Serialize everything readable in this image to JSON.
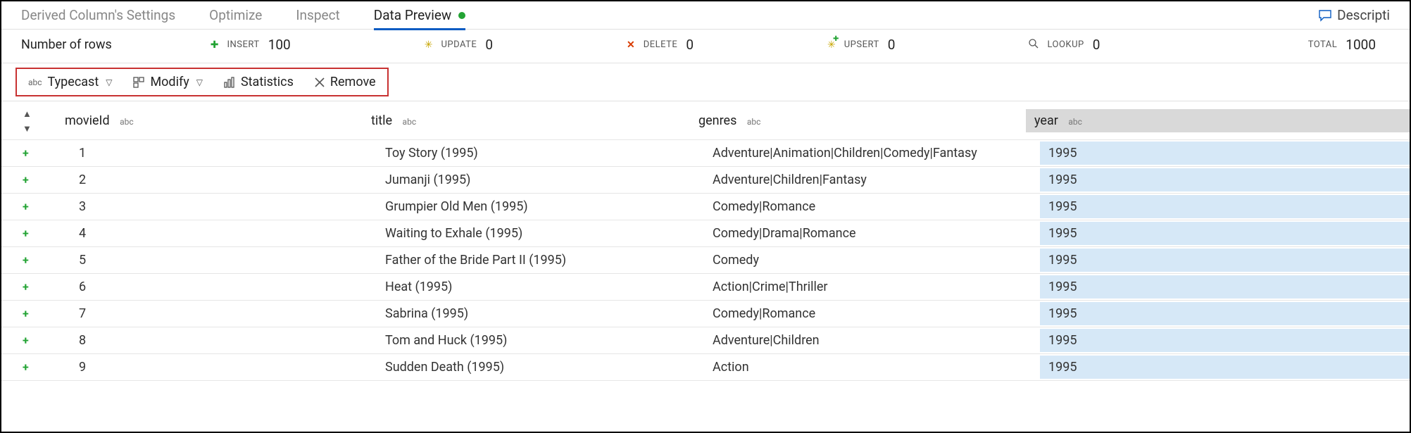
{
  "tabs": [
    {
      "label": "Derived Column's Settings",
      "active": false
    },
    {
      "label": "Optimize",
      "active": false
    },
    {
      "label": "Inspect",
      "active": false
    },
    {
      "label": "Data Preview",
      "active": true
    }
  ],
  "description_label": "Descripti",
  "counts": {
    "row_label": "Number of rows",
    "insert": {
      "label": "INSERT",
      "value": 100
    },
    "update": {
      "label": "UPDATE",
      "value": 0
    },
    "delete": {
      "label": "DELETE",
      "value": 0
    },
    "upsert": {
      "label": "UPSERT",
      "value": 0
    },
    "lookup": {
      "label": "LOOKUP",
      "value": 0
    },
    "total": {
      "label": "TOTAL",
      "value": 1000
    }
  },
  "actions": {
    "typecast": "Typecast",
    "modify": "Modify",
    "statistics": "Statistics",
    "remove": "Remove"
  },
  "table": {
    "columns": {
      "movieId": {
        "header": "movieId",
        "type": "abc"
      },
      "title": {
        "header": "title",
        "type": "abc"
      },
      "genres": {
        "header": "genres",
        "type": "abc"
      },
      "year": {
        "header": "year",
        "type": "abc"
      }
    },
    "rows": [
      {
        "id": "1",
        "title": "Toy Story (1995)",
        "genres": "Adventure|Animation|Children|Comedy|Fantasy",
        "year": "1995"
      },
      {
        "id": "2",
        "title": "Jumanji (1995)",
        "genres": "Adventure|Children|Fantasy",
        "year": "1995"
      },
      {
        "id": "3",
        "title": "Grumpier Old Men (1995)",
        "genres": "Comedy|Romance",
        "year": "1995"
      },
      {
        "id": "4",
        "title": "Waiting to Exhale (1995)",
        "genres": "Comedy|Drama|Romance",
        "year": "1995"
      },
      {
        "id": "5",
        "title": "Father of the Bride Part II (1995)",
        "genres": "Comedy",
        "year": "1995"
      },
      {
        "id": "6",
        "title": "Heat (1995)",
        "genres": "Action|Crime|Thriller",
        "year": "1995"
      },
      {
        "id": "7",
        "title": "Sabrina (1995)",
        "genres": "Comedy|Romance",
        "year": "1995"
      },
      {
        "id": "8",
        "title": "Tom and Huck (1995)",
        "genres": "Adventure|Children",
        "year": "1995"
      },
      {
        "id": "9",
        "title": "Sudden Death (1995)",
        "genres": "Action",
        "year": "1995"
      }
    ]
  }
}
